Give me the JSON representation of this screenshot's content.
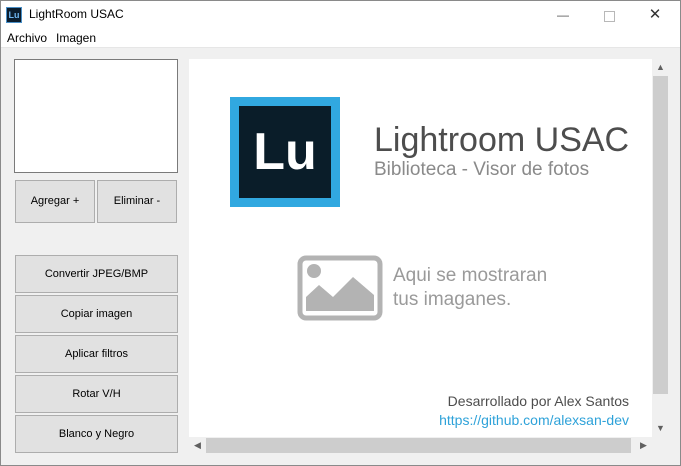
{
  "window": {
    "title": "LightRoom USAC",
    "icon_text": "Lu",
    "controls": {
      "minimize": "—",
      "close": "✕"
    }
  },
  "menu": {
    "archivo": "Archivo",
    "imagen": "Imagen"
  },
  "buttons": {
    "agregar": "Agregar +",
    "eliminar": "Eliminar -",
    "convertir": "Convertir JPEG/BMP",
    "copiar": "Copiar imagen",
    "filtros": "Aplicar filtros",
    "rotar": "Rotar V/H",
    "blanco_negro": "Blanco y Negro"
  },
  "viewer": {
    "logo_text": "Lu",
    "title": "Lightroom USAC",
    "subtitle": "Biblioteca - Visor de fotos",
    "placeholder_line1": "Aqui se mostraran",
    "placeholder_line2": "tus imaganes.",
    "author": "Desarrollado por Alex Santos",
    "link": "https://github.com/alexsan-dev"
  },
  "icons": {
    "app": "lightroom-logo-icon",
    "placeholder": "image-placeholder-icon",
    "scroll_up": "▲",
    "scroll_down": "▼",
    "scroll_left": "◀",
    "scroll_right": "▶"
  },
  "colors": {
    "logo_border": "#31a8e0",
    "logo_background": "#0a1d29",
    "link": "#2ea2d9",
    "button_face": "#e1e1e1"
  }
}
